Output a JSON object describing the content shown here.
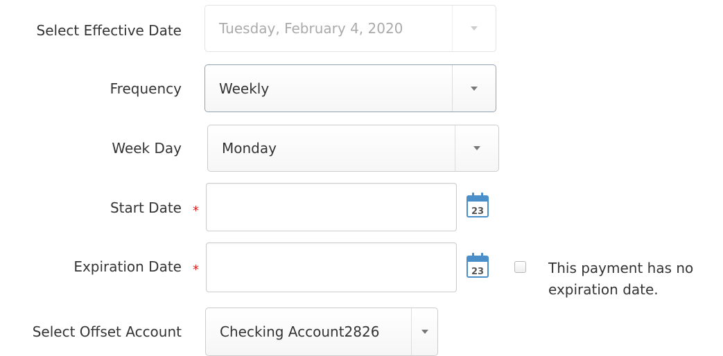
{
  "form": {
    "effective_date": {
      "label": "Select Effective Date",
      "value": "Tuesday, February 4, 2020"
    },
    "frequency": {
      "label": "Frequency",
      "value": "Weekly"
    },
    "week_day": {
      "label": "Week Day",
      "value": "Monday"
    },
    "start_date": {
      "label": "Start Date",
      "required_mark": "*",
      "value": "",
      "calendar_day": "23"
    },
    "expiration_date": {
      "label": "Expiration Date",
      "required_mark": "*",
      "value": "",
      "calendar_day": "23",
      "no_expiration": {
        "checked": false,
        "label_line1": "This payment has no",
        "label_line2": "expiration date."
      }
    },
    "offset_account": {
      "label": "Select Offset Account",
      "value": "Checking Account2826"
    }
  },
  "colors": {
    "required": "#e02020",
    "calendar_blue": "#4a8fc9",
    "text": "#333333",
    "disabled_text": "#aaaaaa"
  },
  "icons": {
    "dropdown": "chevron-down-icon",
    "calendar": "calendar-icon"
  }
}
